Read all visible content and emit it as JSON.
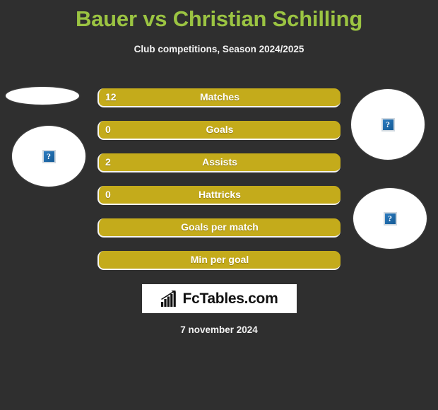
{
  "page": {
    "background_color": "#2f2f2f",
    "title": "Bauer vs Christian Schilling",
    "title_color": "#9bc442",
    "subtitle": "Club competitions, Season 2024/2025",
    "date": "7 november 2024"
  },
  "photos": {
    "left_top": {
      "alt_icon": "broken-image-icon",
      "glyph": "?"
    },
    "left_bottom": {
      "alt_icon": "broken-image-icon",
      "glyph": "?"
    },
    "right_top": {
      "alt_icon": "broken-image-icon",
      "glyph": "?"
    },
    "right_bottom": {
      "alt_icon": "broken-image-icon",
      "glyph": "?"
    }
  },
  "stats": {
    "bar_color": "#c4ab1b",
    "rows": [
      {
        "value": "12",
        "label": "Matches"
      },
      {
        "value": "0",
        "label": "Goals"
      },
      {
        "value": "2",
        "label": "Assists"
      },
      {
        "value": "0",
        "label": "Hattricks"
      },
      {
        "value": "",
        "label": "Goals per match"
      },
      {
        "value": "",
        "label": "Min per goal"
      }
    ]
  },
  "logo": {
    "icon": "bar-chart-arrow-icon",
    "text": "FcTables.com"
  },
  "chart_data": {
    "type": "bar",
    "title": "Bauer vs Christian Schilling",
    "subtitle": "Club competitions, Season 2024/2025",
    "categories": [
      "Matches",
      "Goals",
      "Assists",
      "Hattricks",
      "Goals per match",
      "Min per goal"
    ],
    "values": [
      12,
      0,
      2,
      0,
      null,
      null
    ],
    "value_labels": [
      "12",
      "0",
      "2",
      "0",
      "",
      ""
    ],
    "xlabel": "",
    "ylabel": "",
    "legend": [],
    "grid": false,
    "orientation": "horizontal",
    "note": "Each row is a full-width gold bar; the numeric value is printed at the left edge and the stat name is centered."
  }
}
